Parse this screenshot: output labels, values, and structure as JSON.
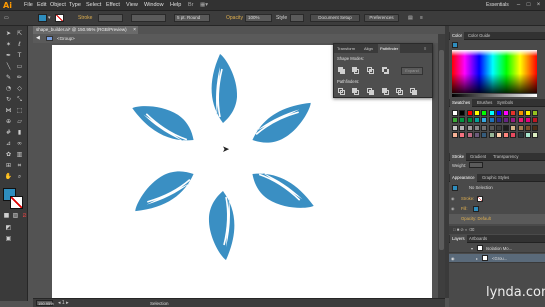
{
  "app": {
    "logo": "Ai",
    "workspace": "Essentials",
    "menu": [
      "File",
      "Edit",
      "Object",
      "Type",
      "Select",
      "Effect",
      "View",
      "Window",
      "Help"
    ]
  },
  "control_bar": {
    "fill_color": "#2e8dbe",
    "stroke_label": "Stroke",
    "stroke_profile": "",
    "brush": "5 pt. Round",
    "opacity_label": "Opacity",
    "opacity_value": "100%",
    "style_label": "Style",
    "doc_setup": "Document Setup",
    "preferences": "Preferences"
  },
  "document": {
    "tab_title": "shape_builder.ai* @ 150.95% (RGB/Preview)",
    "breadcrumb": "<Group>",
    "zoom": "150.95%",
    "status": "Selection"
  },
  "pathfinder_panel": {
    "tabs": [
      "Transform",
      "Align",
      "Pathfinder"
    ],
    "active_tab": "Pathfinder",
    "shape_modes_label": "Shape Modes:",
    "pathfinders_label": "Pathfinders:",
    "expand_label": "Expand"
  },
  "right_panels": {
    "color_tabs": [
      "Color",
      "Color Guide"
    ],
    "swatch_tabs": [
      "Swatches",
      "Brushes",
      "Symbols"
    ],
    "stroke_tabs": [
      "Stroke",
      "Gradient",
      "Transparency"
    ],
    "stroke_weight_label": "Weight:",
    "appearance_tabs": [
      "Appearance",
      "Graphic Styles"
    ],
    "appearance_title": "No Selection",
    "appearance_rows": [
      "Stroke:",
      "Fill:",
      "Opacity: Default"
    ],
    "layers_tabs": [
      "Layers",
      "Artboards"
    ],
    "layer_rows": [
      "Isolation Mo...",
      "<Grou..."
    ]
  },
  "artwork": {
    "petal_color": "#3a8fc3",
    "petal_count": 6
  },
  "watermark": "lynda.com"
}
